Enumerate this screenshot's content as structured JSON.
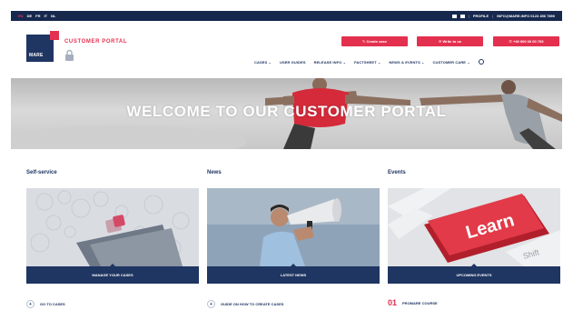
{
  "topbar": {
    "languages": [
      "EN",
      "DE",
      "FR",
      "IT",
      "NL"
    ],
    "profile": "PROFILE",
    "email": "INFO@MARE.INFO 0123 456 7890"
  },
  "header": {
    "logo_text": "MARE",
    "portal_title": "CUSTOMER PORTAL",
    "cta": [
      "Create case",
      "Write to us",
      "+49 000 00 00 765"
    ],
    "nav": [
      "CASES",
      "USER GUIDES",
      "RELEASE INFO",
      "FACTSHEET",
      "NEWS & EVENTS",
      "CUSTOMER CARE"
    ]
  },
  "hero": {
    "title": "WELCOME TO OUR CUSTOMER PORTAL"
  },
  "sections": [
    {
      "title": "Self-service",
      "bar": "MANAGE YOUR CASES",
      "link": "GO TO CASES"
    },
    {
      "title": "News",
      "bar": "LATEST NEWS",
      "link": "GUIDE ON HOW TO CREATE CASES"
    },
    {
      "title": "Events",
      "bar": "UPCOMING EVENTS",
      "link_number": "01",
      "link": "PROMARE COURSE"
    }
  ],
  "keyboard_key": "Learn",
  "keyboard_shift": "Shift",
  "colors": {
    "navy": "#1f3562",
    "accent": "#e4304f"
  }
}
